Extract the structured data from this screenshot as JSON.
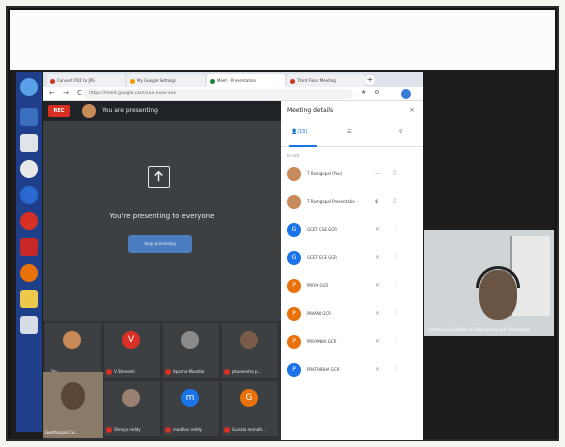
{
  "browser": {
    "tabs": [
      {
        "label": "Convert PDF to JPG",
        "color": "#d93025"
      },
      {
        "label": "My Google Settings",
        "color": "#f29900"
      },
      {
        "label": "Meet - Presentation",
        "color": "#188038"
      },
      {
        "label": "Third Floor Meeting",
        "color": "#d93025"
      }
    ],
    "new_tab": "+",
    "nav_buttons": "← → C",
    "url": "https://meet.google.com/xxx-xxxx-xxx",
    "toolbar_icons": "★ ⚙"
  },
  "meet": {
    "rec_label": "REC",
    "presenting_banner": "You are presenting",
    "presenting_headline": "You're presenting to everyone",
    "stop_presenting_label": "Stop presenting",
    "tiles": [
      {
        "name": "You",
        "initial": "",
        "color": "#c98a5a"
      },
      {
        "name": "V Shreemi",
        "initial": "V",
        "color": "#d93025"
      },
      {
        "name": "Aparna Mandlia",
        "initial": "",
        "color": "#8a8a8a"
      },
      {
        "name": "phanendra p...",
        "initial": "",
        "color": "#7a5a4a"
      },
      {
        "name": "Shreya reddy",
        "initial": "",
        "color": "#9a8070"
      },
      {
        "name": "madhav reddy",
        "initial": "m",
        "color": "#1a73e8"
      },
      {
        "name": "Gunala maruth...",
        "initial": "G",
        "color": "#e8710a"
      }
    ],
    "self_view_name": "Geethanjali Co..."
  },
  "panel": {
    "title": "Meeting details",
    "close": "×",
    "tab_people": "(10)",
    "tab_chat": "☰",
    "tab_activities": "⚲",
    "section": "In call",
    "participants": [
      {
        "name": "T Ramgopal (You)",
        "initial": "",
        "color": "#c98a5a"
      },
      {
        "name": "T Ramgopal Presentation",
        "initial": "",
        "color": "#c98a5a"
      },
      {
        "name": "GCET CSE GCR",
        "initial": "G",
        "color": "#1a73e8"
      },
      {
        "name": "GCET ECE GCR",
        "initial": "G",
        "color": "#1a73e8"
      },
      {
        "name": "PRIYA GCR",
        "initial": "P",
        "color": "#e8710a"
      },
      {
        "name": "PAVANI GCR",
        "initial": "P",
        "color": "#e8710a"
      },
      {
        "name": "PRIYANKA GCR",
        "initial": "P",
        "color": "#e8710a"
      },
      {
        "name": "PRATHIBHA GCR",
        "initial": "P",
        "color": "#1a73e8"
      }
    ]
  },
  "remote": {
    "label": "Geethanjali College of Engineering and Technology"
  }
}
